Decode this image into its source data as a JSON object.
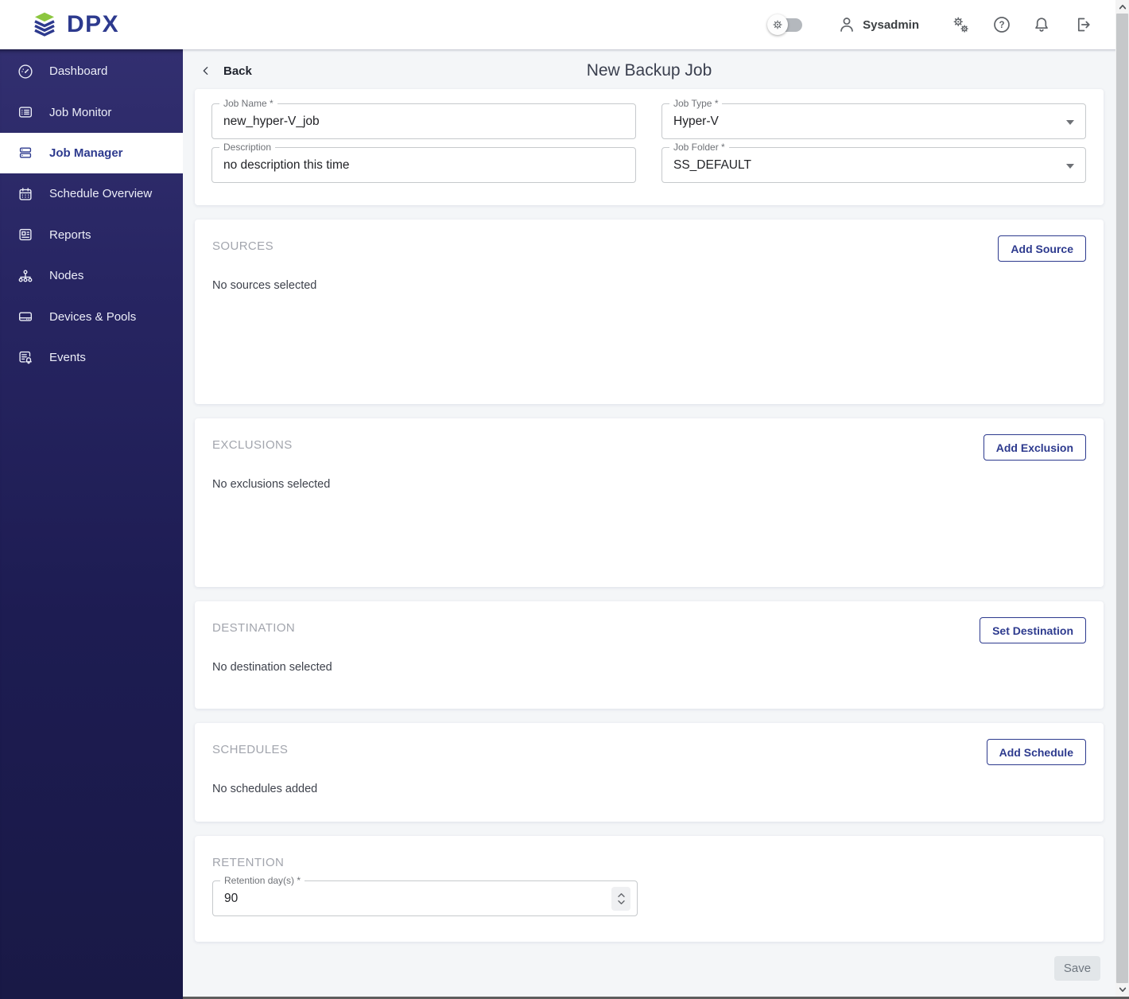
{
  "app": {
    "brand": "DPX"
  },
  "topbar": {
    "user_name": "Sysadmin",
    "help_glyph": "?"
  },
  "sidebar": {
    "items": [
      {
        "label": "Dashboard",
        "active": false
      },
      {
        "label": "Job Monitor",
        "active": false
      },
      {
        "label": "Job Manager",
        "active": true
      },
      {
        "label": "Schedule Overview",
        "active": false
      },
      {
        "label": "Reports",
        "active": false
      },
      {
        "label": "Nodes",
        "active": false
      },
      {
        "label": "Devices & Pools",
        "active": false
      },
      {
        "label": "Events",
        "active": false
      }
    ]
  },
  "page": {
    "back_label": "Back",
    "title": "New Backup Job",
    "save_label": "Save"
  },
  "form": {
    "job_name": {
      "label": "Job Name *",
      "value": "new_hyper-V_job"
    },
    "description": {
      "label": "Description",
      "value": "no description this time"
    },
    "job_type": {
      "label": "Job Type *",
      "value": "Hyper-V"
    },
    "job_folder": {
      "label": "Job Folder *",
      "value": "SS_DEFAULT"
    }
  },
  "sections": {
    "sources": {
      "title": "SOURCES",
      "button_label": "Add Source",
      "empty_text": "No sources selected"
    },
    "exclusions": {
      "title": "EXCLUSIONS",
      "button_label": "Add Exclusion",
      "empty_text": "No exclusions selected"
    },
    "destination": {
      "title": "DESTINATION",
      "button_label": "Set Destination",
      "empty_text": "No destination selected"
    },
    "schedules": {
      "title": "SCHEDULES",
      "button_label": "Add Schedule",
      "empty_text": "No schedules added"
    },
    "retention": {
      "title": "RETENTION",
      "field_label": "Retention day(s) *",
      "value": "90"
    }
  },
  "colors": {
    "accent": "#2d3a8e",
    "logo_green": "#8cc63f",
    "sidebar_top": "#322f70",
    "sidebar_bottom": "#191946"
  }
}
